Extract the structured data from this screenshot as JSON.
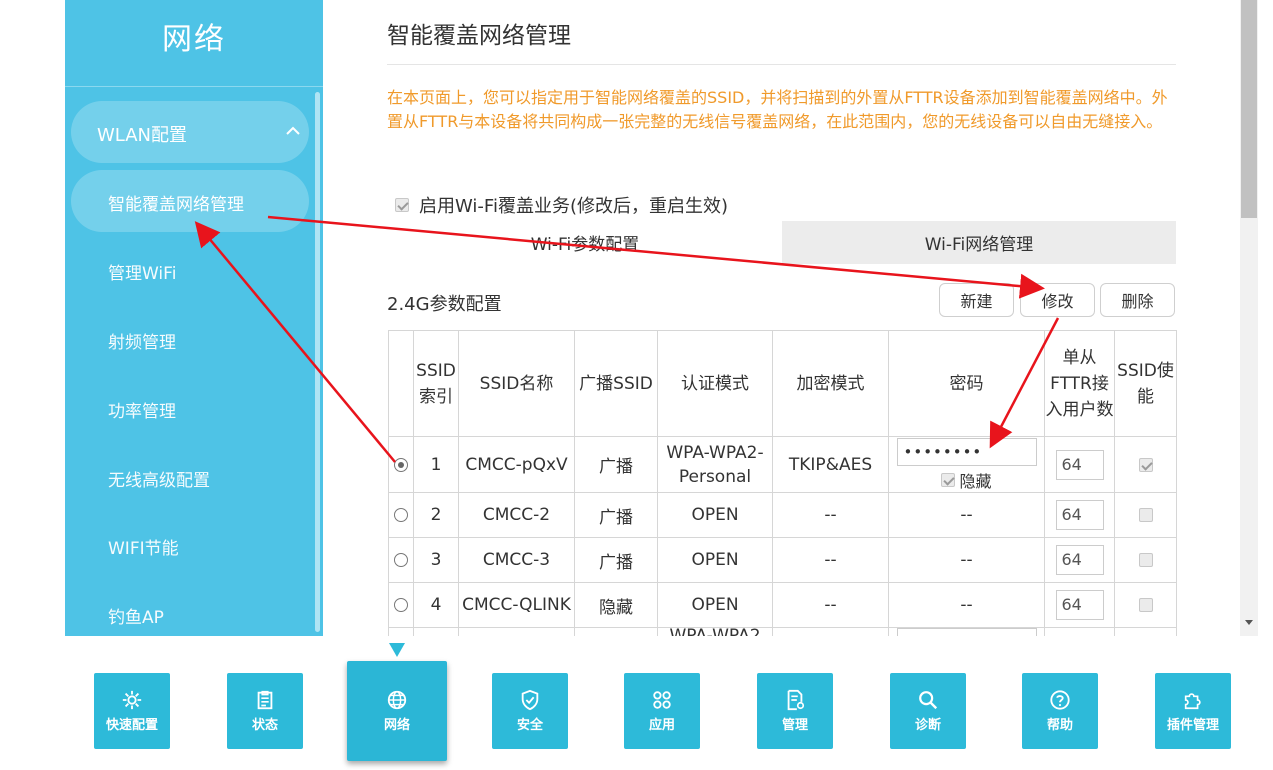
{
  "sidebar": {
    "title": "网络",
    "group_label": "WLAN配置",
    "active_item": "智能覆盖网络管理",
    "items": [
      "管理WiFi",
      "射频管理",
      "功率管理",
      "无线高级配置",
      "WIFI节能",
      "钓鱼AP"
    ]
  },
  "main": {
    "title": "智能覆盖网络管理",
    "intro": "在本页面上，您可以指定用于智能网络覆盖的SSID，并将扫描到的外置从FTTR设备添加到智能覆盖网络中。外置从FTTR与本设备将共同构成一张完整的无线信号覆盖网络，在此范围内，您的无线设备可以自由无缝接入。",
    "enable_label": "启用Wi-Fi覆盖业务(修改后，重启生效)",
    "enable_checked": true,
    "tabs": [
      "Wi-Fi参数配置",
      "Wi-Fi网络管理"
    ],
    "section_title": "2.4G参数配置",
    "buttons": {
      "new": "新建",
      "modify": "修改",
      "delete": "删除"
    }
  },
  "table": {
    "headers": [
      "",
      "SSID索引",
      "SSID名称",
      "广播SSID",
      "认证模式",
      "加密模式",
      "密码",
      "单从FTTR接入用户数",
      "SSID使能"
    ],
    "rows": [
      {
        "selected": true,
        "index": "1",
        "name": "CMCC-pQxV",
        "broadcast": "广播",
        "auth": "WPA-WPA2-Personal",
        "enc": "TKIP&AES",
        "password": "••••••••",
        "hide_label": "隐藏",
        "users": "64",
        "enabled": true
      },
      {
        "selected": false,
        "index": "2",
        "name": "CMCC-2",
        "broadcast": "广播",
        "auth": "OPEN",
        "enc": "--",
        "password": "--",
        "users": "64",
        "enabled": false
      },
      {
        "selected": false,
        "index": "3",
        "name": "CMCC-3",
        "broadcast": "广播",
        "auth": "OPEN",
        "enc": "--",
        "password": "--",
        "users": "64",
        "enabled": false
      },
      {
        "selected": false,
        "index": "4",
        "name": "CMCC-QLINK",
        "broadcast": "隐藏",
        "auth": "OPEN",
        "enc": "--",
        "password": "--",
        "users": "64",
        "enabled": false
      }
    ],
    "partial_row_auth": "WPA-WPA2"
  },
  "toolbar": {
    "items": [
      {
        "label": "快速配置",
        "icon": "gear-icon"
      },
      {
        "label": "状态",
        "icon": "clipboard-icon"
      },
      {
        "label": "网络",
        "icon": "globe-icon",
        "active": true
      },
      {
        "label": "安全",
        "icon": "shield-icon"
      },
      {
        "label": "应用",
        "icon": "apps-icon"
      },
      {
        "label": "管理",
        "icon": "document-gear-icon"
      },
      {
        "label": "诊断",
        "icon": "magnifier-icon"
      },
      {
        "label": "帮助",
        "icon": "help-icon"
      },
      {
        "label": "插件管理",
        "icon": "puzzle-icon"
      }
    ]
  },
  "colors": {
    "sidebar": "#4ec3e6",
    "tool": "#2dbad9",
    "intro_text": "#f09a2b",
    "annotation_arrow": "#e8141c"
  }
}
